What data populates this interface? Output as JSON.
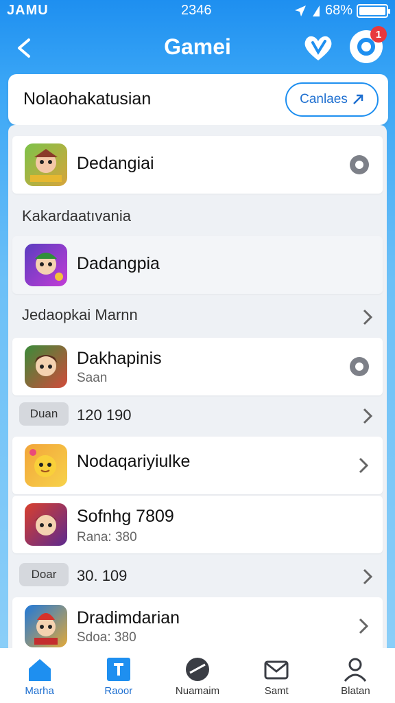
{
  "status": {
    "carrier": "JAMU",
    "time": "2346",
    "battery": "68%",
    "battery_level": 0.9
  },
  "nav": {
    "title": "Gamei",
    "badge_count": "1"
  },
  "header": {
    "title": "Nolaohakatusian",
    "category_button": "Canlaes"
  },
  "rows": [
    {
      "title": "Dedangiai",
      "action": "gear-icon",
      "icon": "game-icon-1"
    },
    {
      "section": "Kakardaatıvania"
    },
    {
      "title": "Dadangpia",
      "icon": "game-icon-2"
    },
    {
      "section": "Jedaopkai Marnn",
      "action": "chevron-right-icon"
    },
    {
      "title": "Dakhapinis",
      "subtitle": "Saan",
      "action": "gear-icon",
      "icon": "game-icon-3"
    },
    {
      "pill": "Duan",
      "value": "120 190",
      "action": "chevron-right-icon"
    },
    {
      "title": "Nodaqariyiulke",
      "action": "chevron-right-icon",
      "icon": "game-icon-4"
    },
    {
      "title": "Sofnhg 7809",
      "subtitle": "Rana: 380",
      "icon": "game-icon-5"
    },
    {
      "pill": "Doar",
      "value": "30. 109",
      "action": "chevron-right-icon"
    },
    {
      "title": "Dradimdarian",
      "subtitle": "Sdoa: 380",
      "action": "chevron-right-icon",
      "icon": "game-icon-6"
    }
  ],
  "tabs": [
    {
      "label": "Marha",
      "icon": "home-icon",
      "active": true
    },
    {
      "label": "Raoor",
      "icon": "calendar-icon",
      "active": true
    },
    {
      "label": "Nuamaim",
      "icon": "globe-icon"
    },
    {
      "label": "Samt",
      "icon": "mail-icon"
    },
    {
      "label": "Blatan",
      "icon": "person-icon"
    }
  ],
  "colors": {
    "accent": "#1e8ff0",
    "badge": "#e8383d",
    "active_tab": "#1e6fd0"
  }
}
